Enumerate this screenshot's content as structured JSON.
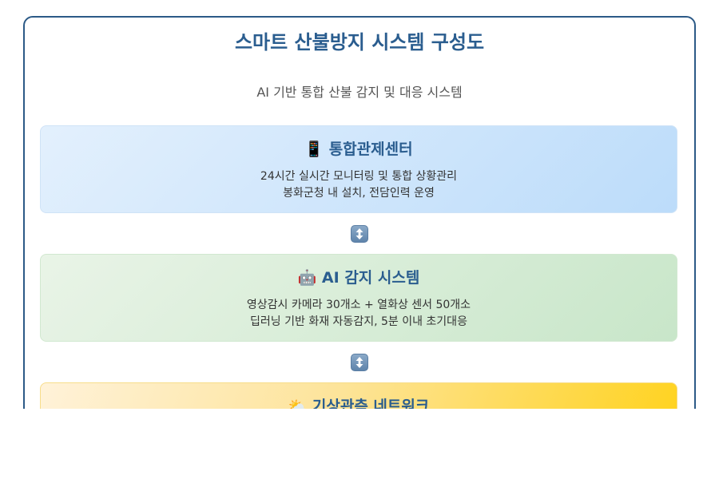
{
  "header": {
    "title": "스마트 산불방지 시스템 구성도",
    "subtitle": "AI 기반 통합 산불 감지 및 대응 시스템"
  },
  "cards": [
    {
      "icon": "mobile-phone-icon",
      "title": "📱 통합관제센터",
      "line1": "24시간 실시간 모니터링 및 통합 상황관리",
      "line2": "봉화군청 내 설치, 전담인력 운영"
    },
    {
      "icon": "robot-icon",
      "title": "🤖 AI 감지 시스템",
      "line1": "영상감시 카메라 30개소 + 열화상 센서 50개소",
      "line2": "딥러닝 기반 화재 자동감지, 5분 이내 초기대응"
    },
    {
      "icon": "sun-behind-cloud-icon",
      "title": "⛅ 기상관측 네트워크",
      "line1": "",
      "line2": ""
    }
  ],
  "connectors": [
    {
      "icon": "up-down-arrow-icon"
    },
    {
      "icon": "up-down-arrow-icon"
    }
  ],
  "colors": {
    "frame_border": "#2c5a87",
    "title": "#2a5d8f",
    "card_control_bg": "#d3e8fc",
    "card_ai_bg": "#d8edd7",
    "card_weather_bg": "#ffd21a"
  }
}
